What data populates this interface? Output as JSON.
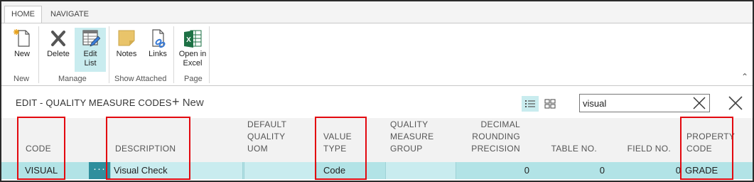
{
  "ribbon": {
    "tabs": [
      {
        "label": "HOME",
        "active": true
      },
      {
        "label": "NAVIGATE",
        "active": false
      }
    ],
    "buttons": {
      "new": "New",
      "delete": "Delete",
      "edit_list_line1": "Edit",
      "edit_list_line2": "List",
      "notes": "Notes",
      "links": "Links",
      "open_excel_line1": "Open in",
      "open_excel_line2": "Excel"
    },
    "groups": {
      "new": "New",
      "manage": "Manage",
      "show_attached": "Show Attached",
      "page": "Page"
    }
  },
  "page": {
    "title": "EDIT - QUALITY MEASURE CODES",
    "new_label": "New",
    "search_value": "visual"
  },
  "grid": {
    "columns": {
      "code": "CODE",
      "description": "DESCRIPTION",
      "default_uom": [
        "DEFAULT",
        "QUALITY",
        "UOM"
      ],
      "value_type": [
        "VALUE",
        "TYPE"
      ],
      "measure_group": [
        "QUALITY",
        "MEASURE",
        "GROUP"
      ],
      "rounding": [
        "DECIMAL",
        "ROUNDING",
        "PRECISION"
      ],
      "table_no": "TABLE NO.",
      "field_no": "FIELD NO.",
      "property_code": [
        "PROPERTY",
        "CODE"
      ]
    },
    "rows": [
      {
        "code": "VISUAL",
        "description": "Visual Check",
        "default_uom": "",
        "value_type": "Code",
        "measure_group": "",
        "rounding": "0",
        "table_no": "0",
        "field_no": "0",
        "property_code": "GRADE"
      }
    ]
  },
  "colors": {
    "selected_row": "#b2e3e6",
    "highlight": "#e3090f",
    "accent": "#2f8f9d",
    "excel_green": "#1e7145"
  },
  "icons": [
    "new-icon",
    "delete-icon",
    "edit-list-icon",
    "notes-icon",
    "links-icon",
    "excel-icon",
    "list-view-icon",
    "tile-view-icon",
    "clear-icon",
    "close-icon"
  ]
}
